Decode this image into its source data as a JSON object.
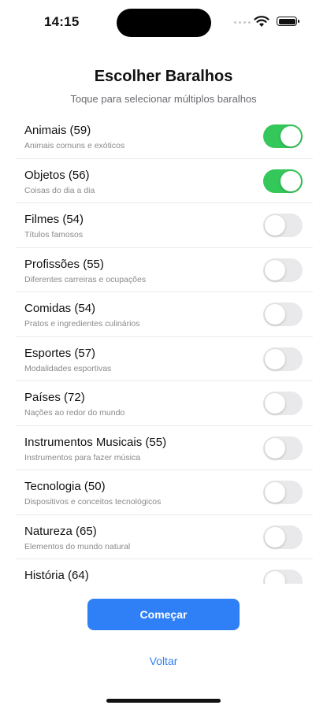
{
  "status": {
    "time": "14:15"
  },
  "header": {
    "title": "Escolher Baralhos",
    "subtitle": "Toque para selecionar múltiplos baralhos"
  },
  "decks": [
    {
      "name": "Animais (59)",
      "description": "Animais comuns e exóticos",
      "selected": true
    },
    {
      "name": "Objetos (56)",
      "description": "Coisas do dia a dia",
      "selected": true
    },
    {
      "name": "Filmes (54)",
      "description": "Títulos famosos",
      "selected": false
    },
    {
      "name": "Profissões (55)",
      "description": "Diferentes carreiras e ocupações",
      "selected": false
    },
    {
      "name": "Comidas (54)",
      "description": "Pratos e ingredientes culinários",
      "selected": false
    },
    {
      "name": "Esportes (57)",
      "description": "Modalidades esportivas",
      "selected": false
    },
    {
      "name": "Países (72)",
      "description": "Nações ao redor do mundo",
      "selected": false
    },
    {
      "name": "Instrumentos Musicais (55)",
      "description": "Instrumentos para fazer música",
      "selected": false
    },
    {
      "name": "Tecnologia (50)",
      "description": "Dispositivos e conceitos tecnológicos",
      "selected": false
    },
    {
      "name": "Natureza (65)",
      "description": "Elementos do mundo natural",
      "selected": false
    },
    {
      "name": "História (64)",
      "description": "",
      "selected": false
    }
  ],
  "actions": {
    "start_label": "Começar",
    "back_label": "Voltar"
  },
  "colors": {
    "accent": "#2f80f7",
    "toggle_on": "#34c759",
    "toggle_off": "#e9e9eb"
  }
}
